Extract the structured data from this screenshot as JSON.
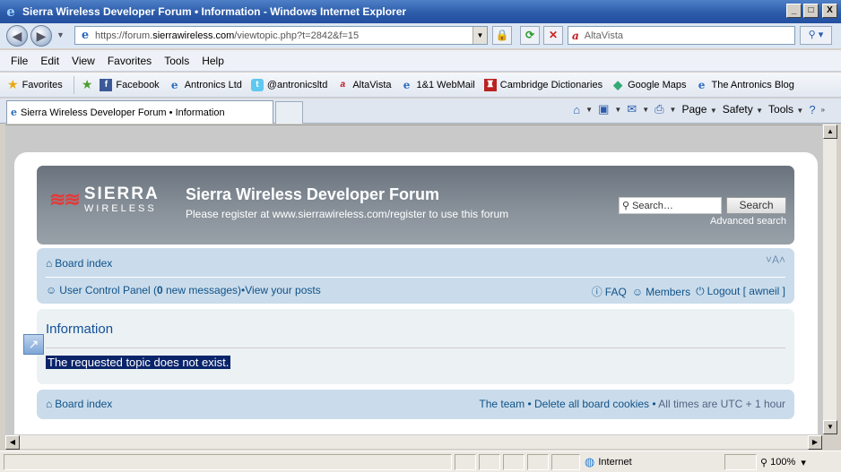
{
  "window": {
    "title": "Sierra Wireless Developer Forum • Information - Windows Internet Explorer",
    "buttons": {
      "minimize": "_",
      "maximize": "□",
      "close": "X"
    }
  },
  "address": {
    "url_prefix": "https://forum.",
    "url_domain": "sierrawireless.com",
    "url_path": "/viewtopic.php?t=2842&f=15",
    "search_placeholder": "AltaVista"
  },
  "menu": [
    "File",
    "Edit",
    "View",
    "Favorites",
    "Tools",
    "Help"
  ],
  "favorites": {
    "label": "Favorites",
    "items": [
      {
        "label": "Facebook",
        "icon": "facebook-icon"
      },
      {
        "label": "Antronics Ltd",
        "icon": "ie-page-icon"
      },
      {
        "label": "@antronicsltd",
        "icon": "twitter-icon"
      },
      {
        "label": "AltaVista",
        "icon": "altavista-icon"
      },
      {
        "label": "1&1 WebMail",
        "icon": "ie-page-icon"
      },
      {
        "label": "Cambridge Dictionaries",
        "icon": "cambridge-icon"
      },
      {
        "label": "Google Maps",
        "icon": "google-maps-icon"
      },
      {
        "label": "The Antronics Blog",
        "icon": "ie-page-icon"
      }
    ]
  },
  "tab": {
    "label": "Sierra Wireless Developer Forum • Information"
  },
  "commandbar": {
    "page": "Page",
    "safety": "Safety",
    "tools": "Tools"
  },
  "forum": {
    "logo_line1": "SIERRA",
    "logo_line2": "WIRELESS",
    "site_title": "Sierra Wireless Developer Forum",
    "site_description": "Please register at www.sierrawireless.com/register to use this forum",
    "search_placeholder": "Search…",
    "search_button": "Search",
    "advanced_search": "Advanced search",
    "board_index": "Board index",
    "ucp_prefix": "User Control Panel (",
    "ucp_count": "0",
    "ucp_suffix": " new messages)",
    "bullet": " • ",
    "view_posts": "View your posts",
    "faq": "FAQ",
    "members": "Members",
    "logout": "Logout [ awneil ]",
    "font_size": "A",
    "panel_title": "Information",
    "message": "The requested topic does not exist.",
    "footer_team": "The team",
    "footer_delete": "Delete all board cookies",
    "footer_times": "All times are UTC + 1 hour"
  },
  "status": {
    "zone": "Internet",
    "zoom": "100%"
  }
}
